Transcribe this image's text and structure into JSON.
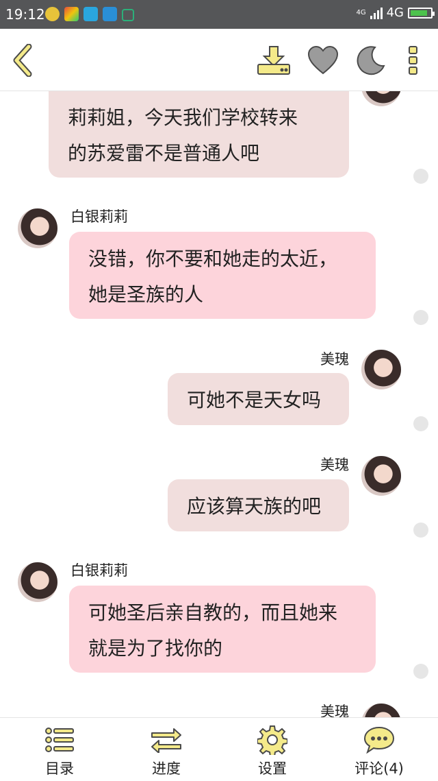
{
  "status_bar": {
    "time": "19:12",
    "network": "4G",
    "network_small": "4G"
  },
  "toolbar": {
    "back_icon": "chevron-left-icon",
    "download_icon": "download-icon",
    "favorite_icon": "heart-icon",
    "night_mode_icon": "moon-icon",
    "more_icon": "more-vertical-icon"
  },
  "messages": [
    {
      "side": "right",
      "name": "",
      "text_lines": [
        "莉莉姐，今天我们学校转来",
        "的苏爱雷不是普通人吧"
      ]
    },
    {
      "side": "left",
      "name": "白银莉莉",
      "text_lines": [
        "没错，你不要和她走的太近，",
        "她是圣族的人"
      ]
    },
    {
      "side": "right",
      "name": "美瑰",
      "text_lines": [
        "可她不是天女吗"
      ]
    },
    {
      "side": "right",
      "name": "美瑰",
      "text_lines": [
        "应该算天族的吧"
      ]
    },
    {
      "side": "left",
      "name": "白银莉莉",
      "text_lines": [
        "可她圣后亲自教的，而且她来",
        "就是为了找你的"
      ]
    },
    {
      "side": "right",
      "name": "美瑰",
      "text_lines": []
    }
  ],
  "bottom_nav": {
    "catalog": "目录",
    "progress": "进度",
    "settings": "设置",
    "comments": "评论(4)"
  },
  "colors": {
    "status_bar_bg": "#555658",
    "self_bubble": "#f1dedd",
    "other_bubble": "#fdd4db",
    "icon_yellow": "#f4ea8a",
    "icon_outline": "#4a4a4a"
  }
}
